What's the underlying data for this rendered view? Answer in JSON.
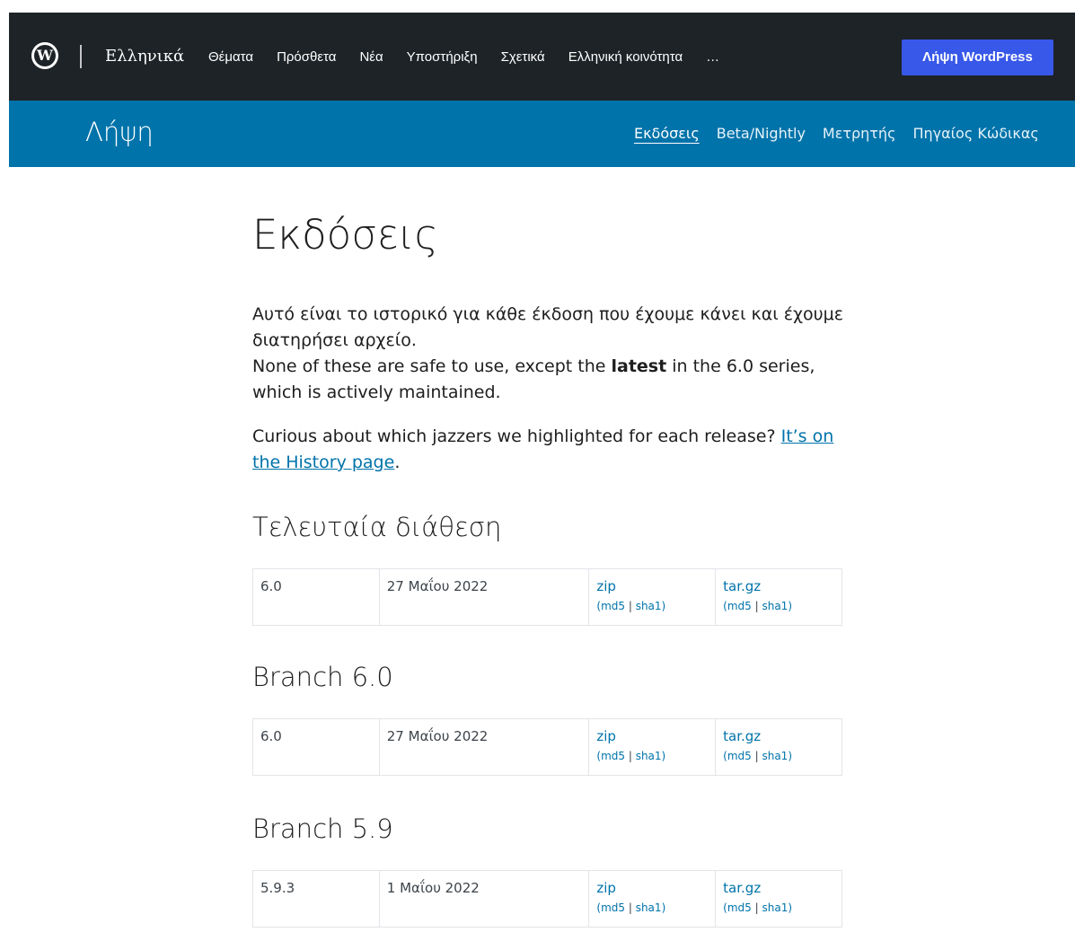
{
  "topbar": {
    "logo_letter": "W",
    "locale": "Ελληνικά",
    "nav": [
      "Θέματα",
      "Πρόσθετα",
      "Νέα",
      "Υποστήριξη",
      "Σχετικά",
      "Ελληνική κοινότητα",
      "…"
    ],
    "cta": "Λήψη WordPress"
  },
  "subbar": {
    "title": "Λήψη",
    "nav": [
      "Εκδόσεις",
      "Beta/Nightly",
      "Μετρητής",
      "Πηγαίος Κώδικας"
    ]
  },
  "page": {
    "title": "Εκδόσεις",
    "intro_line1": "Αυτό είναι το ιστορικό για κάθε έκδοση που έχουμε κάνει και έχουμε διατηρήσει αρχείο.",
    "intro_line2_pre": "None of these are safe to use, except the ",
    "intro_line2_bold": "latest",
    "intro_line2_post": " in the 6.0 series, which is actively maintained.",
    "history_pre": "Curious about which jazzers we highlighted for each release? ",
    "history_link": "It’s on the History page",
    "history_post": "."
  },
  "sections": [
    {
      "title": "Τελευταία διάθεση",
      "version": "6.0",
      "date": "27 Μαΐου 2022"
    },
    {
      "title": "Branch 6.0",
      "version": "6.0",
      "date": "27 Μαΐου 2022"
    },
    {
      "title": "Branch 5.9",
      "version": "5.9.3",
      "date": "1 Μαΐου 2022"
    }
  ],
  "downloads": {
    "zip": "zip",
    "targz": "tar.gz",
    "md5": "md5",
    "sha1": "sha1",
    "open_paren": "(",
    "sep": " | ",
    "close_paren": ")"
  },
  "colors": {
    "topbar": "#1d2327",
    "subbar": "#0073aa",
    "cta": "#3858e9",
    "link": "#0073aa"
  }
}
